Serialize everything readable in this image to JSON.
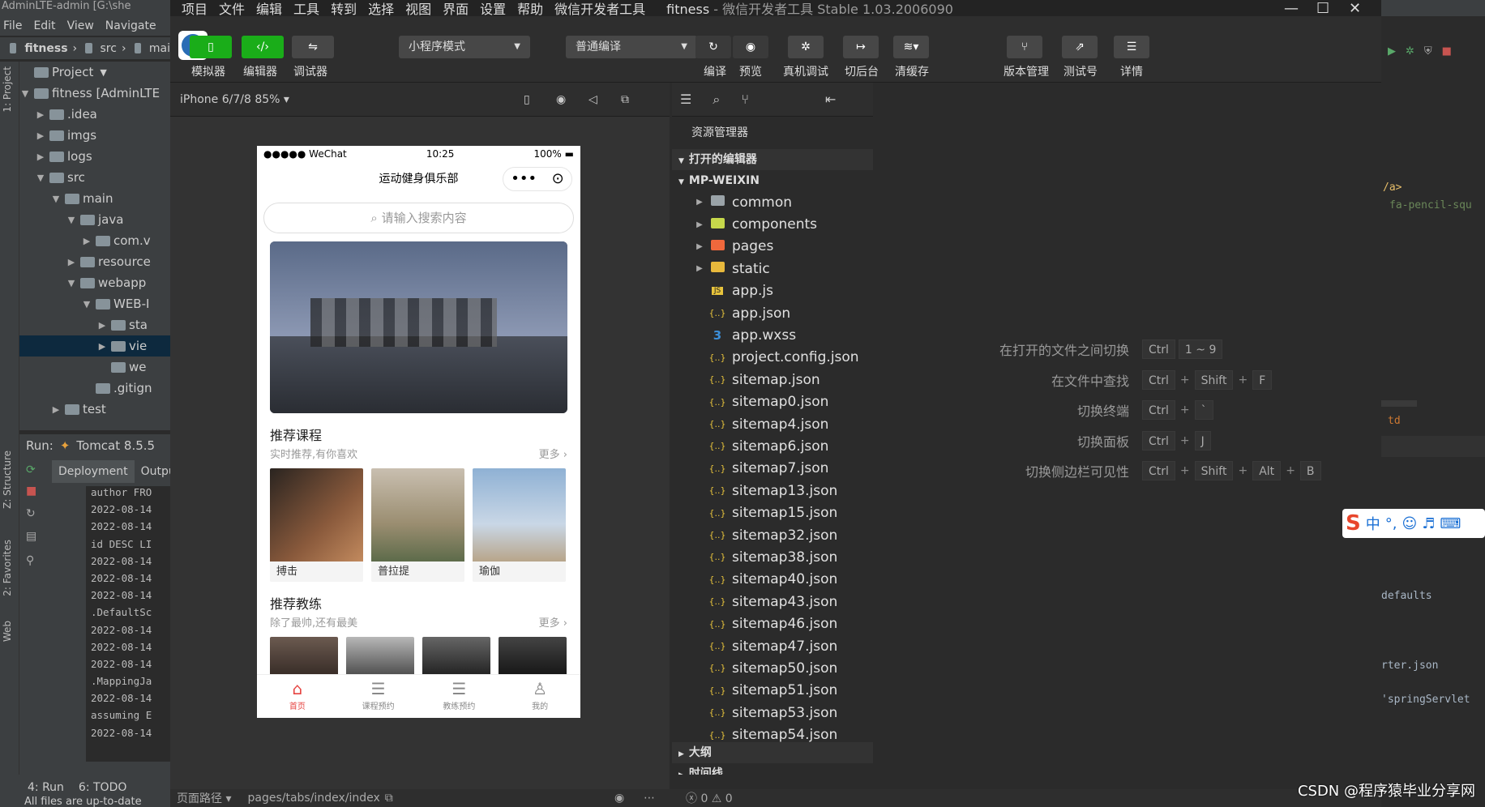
{
  "ij": {
    "title": "AdminLTE-admin [G:\\she",
    "menu": [
      "File",
      "Edit",
      "View",
      "Navigate"
    ],
    "nav": [
      "fitness",
      "src",
      "mai"
    ],
    "project_header": "Project",
    "tree": [
      {
        "label": "fitness [AdminLTE",
        "indent": 0,
        "arrow": "▼",
        "sel": false
      },
      {
        "label": ".idea",
        "indent": 1,
        "arrow": "▶",
        "sel": false
      },
      {
        "label": "imgs",
        "indent": 1,
        "arrow": "▶",
        "sel": false
      },
      {
        "label": "logs",
        "indent": 1,
        "arrow": "▶",
        "sel": false
      },
      {
        "label": "src",
        "indent": 1,
        "arrow": "▼",
        "sel": false
      },
      {
        "label": "main",
        "indent": 2,
        "arrow": "▼",
        "sel": false
      },
      {
        "label": "java",
        "indent": 3,
        "arrow": "▼",
        "sel": false
      },
      {
        "label": "com.v",
        "indent": 4,
        "arrow": "▶",
        "sel": false
      },
      {
        "label": "resource",
        "indent": 3,
        "arrow": "▶",
        "sel": false
      },
      {
        "label": "webapp",
        "indent": 3,
        "arrow": "▼",
        "sel": false
      },
      {
        "label": "WEB-I",
        "indent": 4,
        "arrow": "▼",
        "sel": false
      },
      {
        "label": "sta",
        "indent": 5,
        "arrow": "▶",
        "sel": false
      },
      {
        "label": "vie",
        "indent": 5,
        "arrow": "▶",
        "sel": true
      },
      {
        "label": "we",
        "indent": 5,
        "arrow": "",
        "sel": false
      },
      {
        "label": ".gitign",
        "indent": 4,
        "arrow": "",
        "sel": false
      },
      {
        "label": "test",
        "indent": 2,
        "arrow": "▶",
        "sel": false
      }
    ],
    "run_label": "Run:",
    "run_config": "Tomcat 8.5.5",
    "run_tabs": [
      "Deployment",
      "Outpu"
    ],
    "log_lines": [
      "author FRO",
      "2022-08-14",
      "2022-08-14",
      "id DESC LI",
      "2022-08-14",
      "2022-08-14",
      "2022-08-14",
      ".DefaultSc",
      "2022-08-14",
      "2022-08-14",
      "2022-08-14",
      ".MappingJa",
      "2022-08-14",
      "assuming E",
      "2022-08-14"
    ],
    "vertical_tabs": [
      "1: Project",
      "Z: Structure",
      "2: Favorites",
      "Web"
    ],
    "bottom_tabs": [
      "4: Run",
      "6: TODO"
    ],
    "status": "All files are up-to-date"
  },
  "wx": {
    "menu": [
      "项目",
      "文件",
      "编辑",
      "工具",
      "转到",
      "选择",
      "视图",
      "界面",
      "设置",
      "帮助",
      "微信开发者工具"
    ],
    "app_name": "fitness",
    "app_version": " - 微信开发者工具 Stable 1.03.2006090",
    "toolbar": {
      "simulator": "模拟器",
      "editor": "编辑器",
      "debugger": "调试器",
      "mode": "小程序模式",
      "compile_mode": "普通编译",
      "compile": "编译",
      "preview": "预览",
      "remote_debug": "真机调试",
      "background": "切后台",
      "clear_cache": "清缓存",
      "version": "版本管理",
      "test_id": "测试号",
      "details": "详情"
    },
    "device": "iPhone 6/7/8 85% ▾",
    "phone": {
      "carrier": "●●●●● WeChat",
      "time": "10:25",
      "battery": "100%",
      "title": "运动健身俱乐部",
      "search_placeholder": "请输入搜索内容",
      "sec1_title": "推荐课程",
      "sec1_sub": "实时推荐,有你喜欢",
      "more": "更多",
      "courses": [
        "搏击",
        "普拉提",
        "瑜伽"
      ],
      "sec2_title": "推荐教练",
      "sec2_sub": "除了最帅,还有最美",
      "tabs": [
        "首页",
        "课程预约",
        "教练预约",
        "我的"
      ]
    },
    "explorer": {
      "title": "资源管理器",
      "open_editors": "打开的编辑器",
      "project": "MP-WEIXIN",
      "items": [
        {
          "label": "common",
          "type": "folder",
          "color": "#9aa3a8"
        },
        {
          "label": "components",
          "type": "folder",
          "color": "#c6d84b"
        },
        {
          "label": "pages",
          "type": "folder",
          "color": "#f0683c"
        },
        {
          "label": "static",
          "type": "folder",
          "color": "#e8b93c"
        },
        {
          "label": "app.js",
          "type": "js"
        },
        {
          "label": "app.json",
          "type": "json"
        },
        {
          "label": "app.wxss",
          "type": "wxss"
        },
        {
          "label": "project.config.json",
          "type": "json"
        },
        {
          "label": "sitemap.json",
          "type": "json"
        },
        {
          "label": "sitemap0.json",
          "type": "json"
        },
        {
          "label": "sitemap4.json",
          "type": "json"
        },
        {
          "label": "sitemap6.json",
          "type": "json"
        },
        {
          "label": "sitemap7.json",
          "type": "json"
        },
        {
          "label": "sitemap13.json",
          "type": "json"
        },
        {
          "label": "sitemap15.json",
          "type": "json"
        },
        {
          "label": "sitemap32.json",
          "type": "json"
        },
        {
          "label": "sitemap38.json",
          "type": "json"
        },
        {
          "label": "sitemap40.json",
          "type": "json"
        },
        {
          "label": "sitemap43.json",
          "type": "json"
        },
        {
          "label": "sitemap46.json",
          "type": "json"
        },
        {
          "label": "sitemap47.json",
          "type": "json"
        },
        {
          "label": "sitemap50.json",
          "type": "json"
        },
        {
          "label": "sitemap51.json",
          "type": "json"
        },
        {
          "label": "sitemap53.json",
          "type": "json"
        },
        {
          "label": "sitemap54.json",
          "type": "json"
        }
      ],
      "outline": "大纲",
      "timeline": "时间线"
    },
    "shortcuts": [
      {
        "label": "在打开的文件之间切换",
        "keys": [
          "Ctrl",
          "1 ~ 9"
        ],
        "joined": false
      },
      {
        "label": "在文件中查找",
        "keys": [
          "Ctrl",
          "Shift",
          "F"
        ],
        "joined": true
      },
      {
        "label": "切换终端",
        "keys": [
          "Ctrl",
          "`"
        ],
        "joined": true
      },
      {
        "label": "切换面板",
        "keys": [
          "Ctrl",
          "J"
        ],
        "joined": true
      },
      {
        "label": "切换侧边栏可见性",
        "keys": [
          "Ctrl",
          "Shift",
          "Alt",
          "B"
        ],
        "joined": true
      }
    ],
    "page_path_label": "页面路径 ▾",
    "page_path": "pages/tabs/index/index",
    "problems": "ⓧ 0 ⚠ 0"
  },
  "right_code": [
    "/a>",
    "fa-pencil-squ",
    "td",
    "defaults",
    "rter.json",
    "'springServlet"
  ],
  "watermark": "CSDN @程序猿毕业分享网",
  "ime": "中"
}
